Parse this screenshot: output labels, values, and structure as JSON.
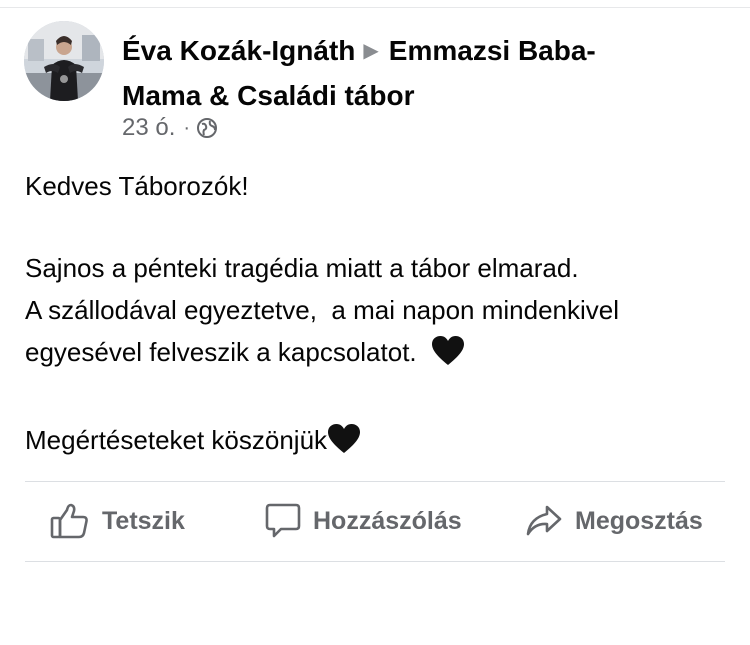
{
  "post": {
    "author": "Éva Kozák-Ignáth",
    "separator": "▶",
    "group_line1": "Emmazsi Baba-",
    "group_line2": "Mama & Családi tábor",
    "time": "23 ó.",
    "meta_dot": "·",
    "privacy_icon": "globe-icon",
    "body": {
      "greeting": "Kedves Táborozók!",
      "line1": "Sajnos a pénteki tragédia miatt a tábor elmarad.",
      "line2": "A szállodával egyeztetve,  a mai napon mindenkivel",
      "line3": "egyesével felveszik a kapcsolatot.  ",
      "closing": "Megértéseteket köszönjük",
      "emoji": "black-heart-icon"
    }
  },
  "actions": {
    "like": {
      "label": "Tetszik",
      "icon": "thumbs-up-icon"
    },
    "comment": {
      "label": "Hozzászólás",
      "icon": "comment-bubble-icon"
    },
    "share": {
      "label": "Megosztás",
      "icon": "share-arrow-icon"
    }
  },
  "colors": {
    "text": "#050505",
    "secondary": "#65676b",
    "divider": "#dcdfe3"
  }
}
